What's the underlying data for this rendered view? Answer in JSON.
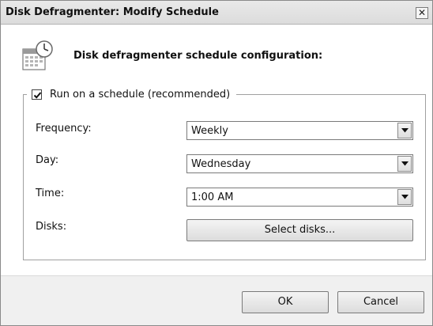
{
  "window": {
    "title": "Disk Defragmenter: Modify Schedule",
    "close_glyph": "✕"
  },
  "header": {
    "icon": "calendar-clock-icon",
    "text": "Disk defragmenter schedule configuration:"
  },
  "schedule": {
    "run_checkbox_checked": true,
    "run_label": "Run on a schedule (recommended)",
    "frequency_label": "Frequency:",
    "frequency_value": "Weekly",
    "day_label": "Day:",
    "day_value": "Wednesday",
    "time_label": "Time:",
    "time_value": "1:00 AM",
    "disks_label": "Disks:",
    "select_disks_label": "Select disks..."
  },
  "footer": {
    "ok_label": "OK",
    "cancel_label": "Cancel"
  }
}
